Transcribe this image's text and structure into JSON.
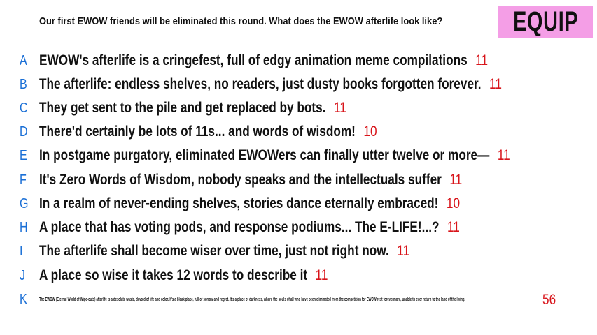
{
  "prompt": "Our first EWOW friends will be eliminated this round. What does the EWOW afterlife look like?",
  "brand": {
    "label": "EQUIP",
    "color": "#f49ee6"
  },
  "colors": {
    "letter": "#1a6fd6",
    "count": "#d8141a",
    "text": "#111111"
  },
  "responses": [
    {
      "letter": "A",
      "text": "EWOW's afterlife is a cringefest, full of edgy animation meme compilations",
      "count": "11"
    },
    {
      "letter": "B",
      "text": "The afterlife: endless shelves, no readers, just dusty books forgotten forever.",
      "count": "11"
    },
    {
      "letter": "C",
      "text": "They get sent to the pile and get replaced by bots.",
      "count": "11"
    },
    {
      "letter": "D",
      "text": "There'd certainly be lots of 11s... and words of wisdom!",
      "count": "10"
    },
    {
      "letter": "E",
      "text": "In postgame purgatory, eliminated EWOWers can finally utter twelve or more—",
      "count": "11"
    },
    {
      "letter": "F",
      "text": "It's Zero Words of Wisdom, nobody speaks and the intellectuals suffer",
      "count": "11"
    },
    {
      "letter": "G",
      "text": "In a realm of never-ending shelves, stories dance eternally embraced!",
      "count": "10"
    },
    {
      "letter": "H",
      "text": "A place that has voting pods, and response podiums... The E-LIFE!...?",
      "count": "11"
    },
    {
      "letter": "I",
      "text": "The afterlife shall become wiser over time, just not right now.",
      "count": "11"
    },
    {
      "letter": "J",
      "text": "A place so wise it takes 12 words to describe it",
      "count": "11"
    },
    {
      "letter": "K",
      "text": "The EWOW (Eternal World of Wipe-outs) afterlife is a desolate waste, devoid of life and color. It's a bleak place, full of sorrow and regret. It's a place of darkness, where the souls of all who have been eliminated from the competition for EWOW rest forevermore, unable to ever return to the land of the living.",
      "count": "56"
    }
  ]
}
